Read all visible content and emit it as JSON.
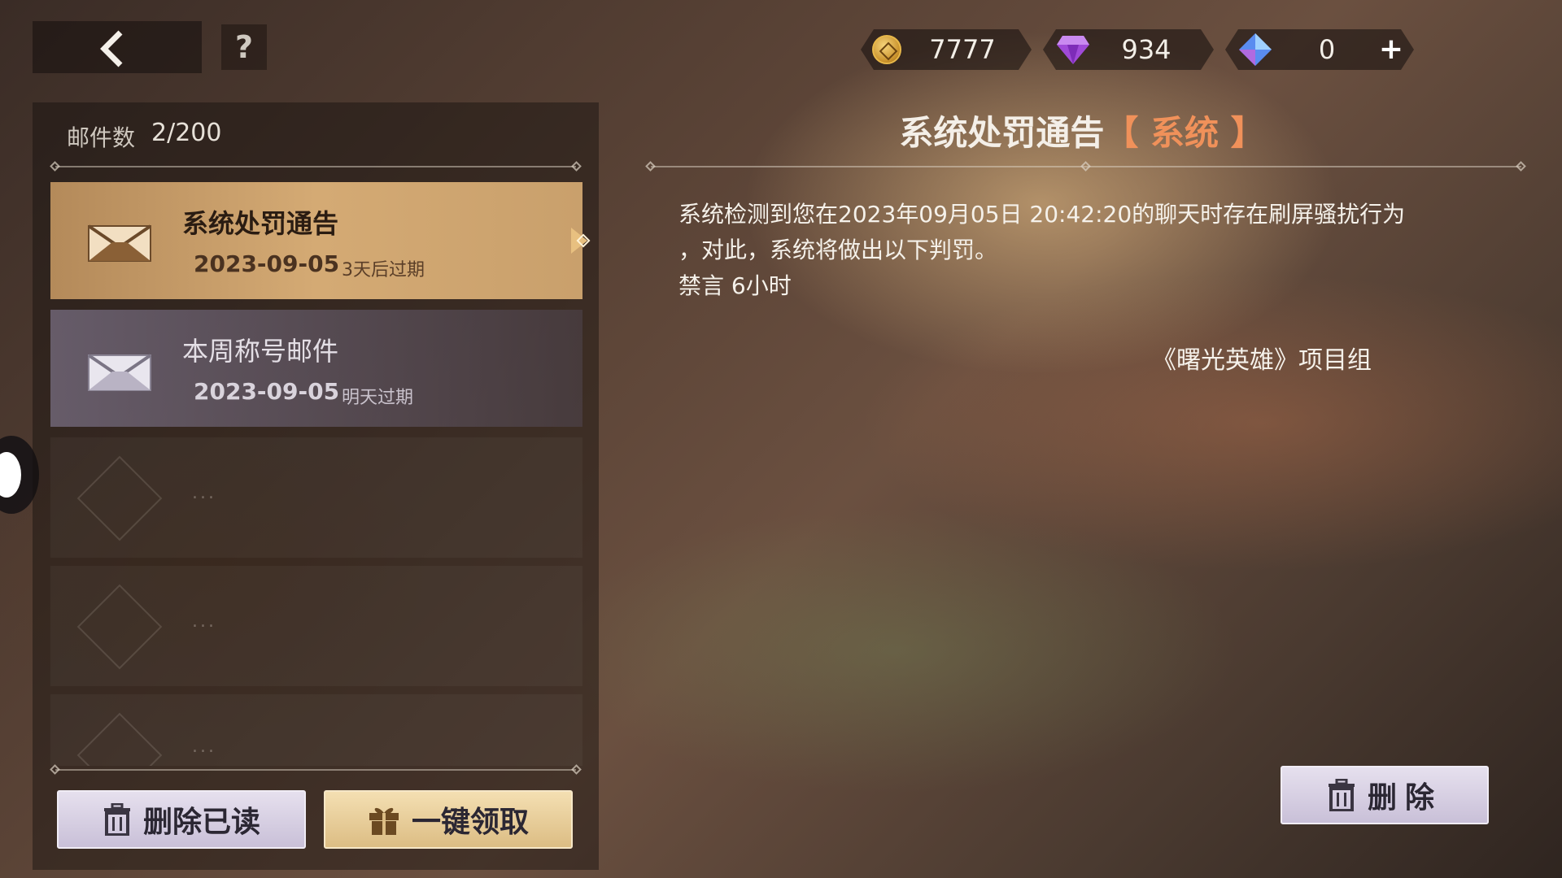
{
  "header": {
    "help_label": "?"
  },
  "currencies": [
    {
      "icon": "gold-coin-icon",
      "value": "7777"
    },
    {
      "icon": "purple-gem-icon",
      "value": "934"
    },
    {
      "icon": "blue-crystal-icon",
      "value": "0"
    }
  ],
  "plus_label": "+",
  "mailbox": {
    "count_label": "邮件数",
    "count_value": "2/200",
    "items": [
      {
        "title": "系统处罚通告",
        "date": "2023-09-05",
        "expiry": "3天后过期",
        "selected": true
      },
      {
        "title": "本周称号邮件",
        "date": "2023-09-05",
        "expiry": "明天过期",
        "selected": false
      }
    ],
    "empty_slots": [
      "...",
      "...",
      "..."
    ],
    "delete_read_label": "删除已读",
    "claim_all_label": "一键领取"
  },
  "detail": {
    "title": "系统处罚通告",
    "tag": "【 系统 】",
    "body_line1": "系统检测到您在2023年09月05日 20:42:20的聊天时存在刷屏骚扰行为",
    "body_line2": "，对此，系统将做出以下判罚。",
    "body_line3": "禁言 6小时",
    "signature": "《曙光英雄》项目组",
    "delete_label": "删除"
  },
  "colors": {
    "selected_item": "#d4aa74",
    "tag_orange": "#f0915a",
    "button_lavender": "#e6e0ee",
    "button_gold": "#f4dfb2"
  }
}
